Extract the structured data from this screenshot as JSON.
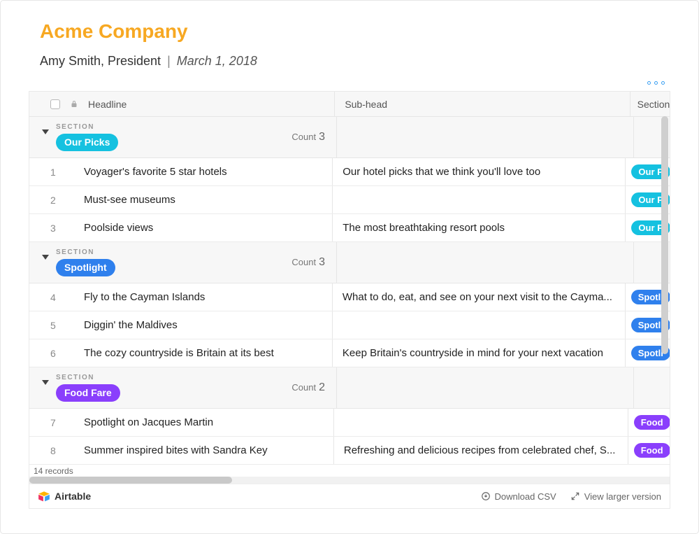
{
  "header": {
    "title": "Acme Company",
    "author": "Amy Smith, President",
    "separator": "|",
    "date": "March 1, 2018"
  },
  "columns": {
    "headline": "Headline",
    "subhead": "Sub-head",
    "section": "Section"
  },
  "section_label": "SECTION",
  "count_label": "Count",
  "sections": [
    {
      "name": "Our Picks",
      "color": "cyan",
      "count": "3",
      "rows": [
        {
          "n": "1",
          "headline": "Voyager's favorite 5 star hotels",
          "subhead": "Our hotel picks that we think you'll love too",
          "tag": "Our P",
          "tag_color": "cyan"
        },
        {
          "n": "2",
          "headline": "Must-see museums",
          "subhead": "",
          "tag": "Our P",
          "tag_color": "cyan"
        },
        {
          "n": "3",
          "headline": "Poolside views",
          "subhead": "The most breathtaking resort pools",
          "tag": "Our P",
          "tag_color": "cyan"
        }
      ]
    },
    {
      "name": "Spotlight",
      "color": "blue",
      "count": "3",
      "rows": [
        {
          "n": "4",
          "headline": "Fly to the Cayman Islands",
          "subhead": "What to do, eat, and see on your next visit to the Cayma...",
          "tag": "Spotli",
          "tag_color": "blue"
        },
        {
          "n": "5",
          "headline": "Diggin' the Maldives",
          "subhead": "",
          "tag": "Spotli",
          "tag_color": "blue"
        },
        {
          "n": "6",
          "headline": "The cozy countryside is Britain at its best",
          "subhead": "Keep Britain's countryside in mind for your next vacation",
          "tag": "Spotli",
          "tag_color": "blue"
        }
      ]
    },
    {
      "name": "Food Fare",
      "color": "purple",
      "count": "2",
      "rows": [
        {
          "n": "7",
          "headline": "Spotlight on Jacques Martin",
          "subhead": "",
          "tag": "Food ",
          "tag_color": "purple"
        },
        {
          "n": "8",
          "headline": "Summer inspired bites with Sandra Key",
          "subhead": "Refreshing and delicious recipes from celebrated chef, S...",
          "tag": "Food ",
          "tag_color": "purple"
        }
      ]
    }
  ],
  "records_text": "14 records",
  "footer": {
    "brand": "Airtable",
    "download": "Download CSV",
    "view_larger": "View larger version"
  }
}
